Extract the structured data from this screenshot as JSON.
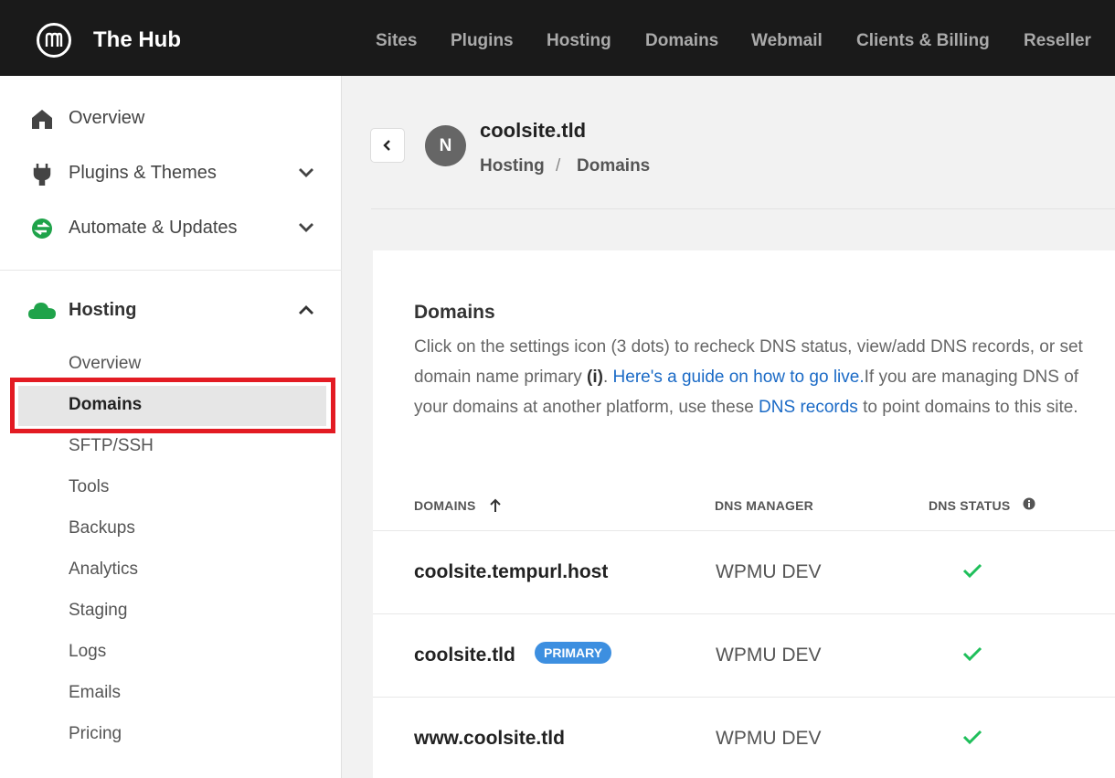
{
  "app": {
    "brand": "The Hub"
  },
  "topnav": [
    "Sites",
    "Plugins",
    "Hosting",
    "Domains",
    "Webmail",
    "Clients & Billing",
    "Reseller"
  ],
  "sidebar": {
    "items": [
      {
        "label": "Overview",
        "icon": "home-icon"
      },
      {
        "label": "Plugins & Themes",
        "icon": "plug-icon"
      },
      {
        "label": "Automate & Updates",
        "icon": "automate-icon"
      }
    ],
    "hosting": {
      "label": "Hosting",
      "icon": "cloud-icon",
      "sub": [
        "Overview",
        "Domains",
        "SFTP/SSH",
        "Tools",
        "Backups",
        "Analytics",
        "Staging",
        "Logs",
        "Emails",
        "Pricing"
      ],
      "active": "Domains"
    }
  },
  "header": {
    "avatar_initial": "N",
    "site_name": "coolsite.tld",
    "breadcrumb": [
      "Hosting",
      "Domains"
    ],
    "breadcrumb_sep": "/"
  },
  "card": {
    "title": "Domains",
    "desc_1": "Click on the settings icon (3 dots) to recheck DNS status, view/add DNS records, or set domain name primary ",
    "desc_bold": "(i)",
    "desc_2": ". ",
    "guide_link": "Here's a guide on how to go live.",
    "desc_3": "If you are managing DNS of your domains at another platform, use these ",
    "dns_link": "DNS records",
    "desc_4": " to point domains to this site."
  },
  "table": {
    "headers": {
      "domains": "DOMAINS",
      "dns_manager": "DNS MANAGER",
      "dns_status": "DNS STATUS"
    },
    "rows": [
      {
        "domain": "coolsite.tempurl.host",
        "manager": "WPMU DEV",
        "status": "ok",
        "badge": ""
      },
      {
        "domain": "coolsite.tld",
        "manager": "WPMU DEV",
        "status": "ok",
        "badge": "PRIMARY"
      },
      {
        "domain": "www.coolsite.tld",
        "manager": "WPMU DEV",
        "status": "ok",
        "badge": ""
      }
    ]
  },
  "colors": {
    "topbar": "#1a1a1a",
    "accent": "#1a6ac6",
    "check": "#1fbf5b",
    "badge": "#3d8fe0",
    "highlight": "#e31b23"
  }
}
